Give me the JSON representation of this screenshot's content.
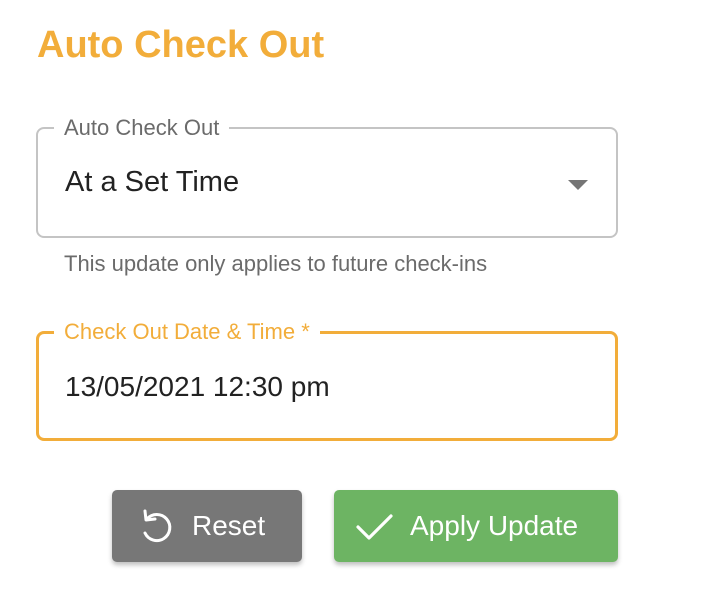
{
  "page": {
    "title": "Auto Check Out"
  },
  "auto_check_out_field": {
    "label": "Auto Check Out",
    "selected_value": "At a Set Time",
    "helper_text": "This update only applies to future check-ins"
  },
  "check_out_datetime_field": {
    "label": "Check Out Date & Time *",
    "value": "13/05/2021 12:30 pm"
  },
  "actions": {
    "reset_label": "Reset",
    "reset_icon": "undo-icon",
    "apply_label": "Apply Update",
    "apply_icon": "check-icon"
  },
  "colors": {
    "accent": "#f2ad3a",
    "reset_button": "#777777",
    "apply_button": "#6db463",
    "outline_idle": "#c4c4c4"
  }
}
